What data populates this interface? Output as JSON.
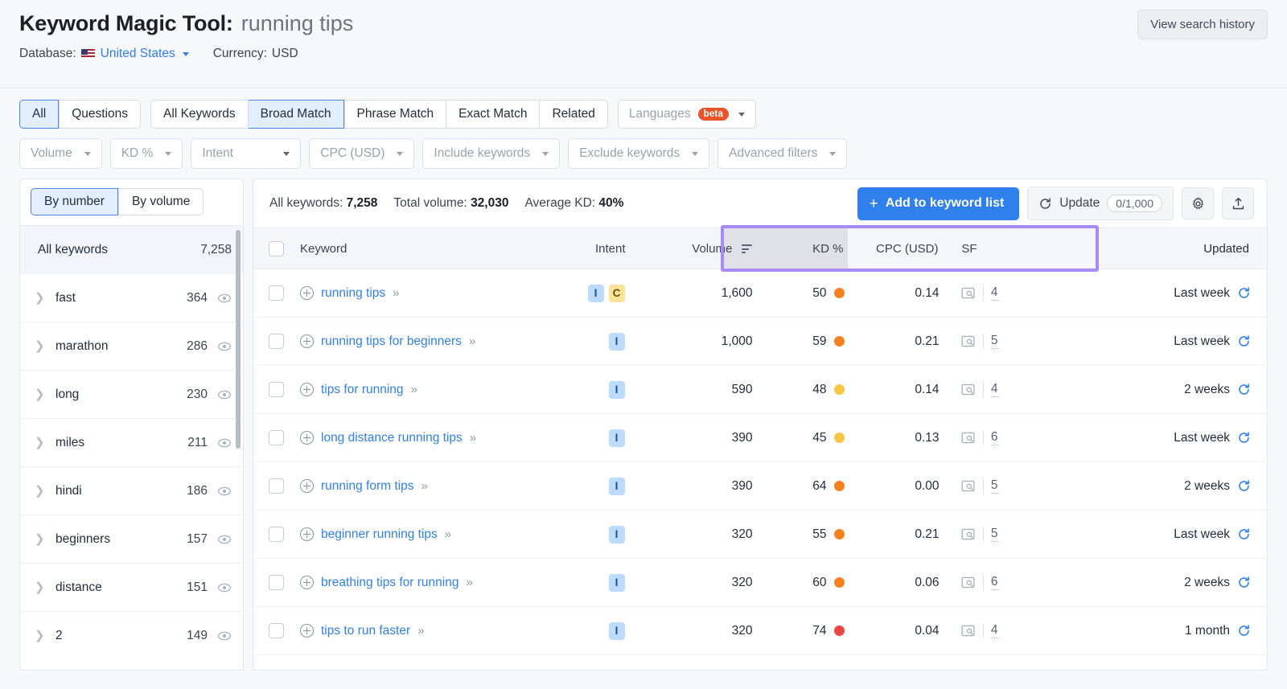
{
  "header": {
    "title_main": "Keyword Magic Tool:",
    "title_query": "running tips",
    "database_label": "Database:",
    "database_value": "United States",
    "currency_label": "Currency:",
    "currency_value": "USD",
    "search_history_button": "View search history"
  },
  "filters": {
    "match_tabs_group1": [
      {
        "label": "All",
        "active": true
      },
      {
        "label": "Questions",
        "active": false
      }
    ],
    "match_tabs_group2": [
      {
        "label": "All Keywords",
        "active": false
      },
      {
        "label": "Broad Match",
        "active": true
      },
      {
        "label": "Phrase Match",
        "active": false
      },
      {
        "label": "Exact Match",
        "active": false
      },
      {
        "label": "Related",
        "active": false
      }
    ],
    "languages_label": "Languages",
    "languages_beta": "beta",
    "dropdowns": [
      {
        "label": "Volume"
      },
      {
        "label": "KD %"
      },
      {
        "label": "Intent"
      },
      {
        "label": "CPC (USD)"
      },
      {
        "label": "Include keywords"
      },
      {
        "label": "Exclude keywords"
      },
      {
        "label": "Advanced filters"
      }
    ]
  },
  "sidebar": {
    "toggle": [
      {
        "label": "By number",
        "active": true
      },
      {
        "label": "By volume",
        "active": false
      }
    ],
    "all_keywords_label": "All keywords",
    "all_keywords_count": "7,258",
    "groups": [
      {
        "name": "fast",
        "count": "364"
      },
      {
        "name": "marathon",
        "count": "286"
      },
      {
        "name": "long",
        "count": "230"
      },
      {
        "name": "miles",
        "count": "211"
      },
      {
        "name": "hindi",
        "count": "186"
      },
      {
        "name": "beginners",
        "count": "157"
      },
      {
        "name": "distance",
        "count": "151"
      },
      {
        "name": "2",
        "count": "149"
      }
    ]
  },
  "toolbar": {
    "all_keywords_label": "All keywords:",
    "all_keywords_value": "7,258",
    "total_volume_label": "Total volume:",
    "total_volume_value": "32,030",
    "average_kd_label": "Average KD:",
    "average_kd_value": "40%",
    "add_button": "Add to keyword list",
    "add_button_plus": "+",
    "update_label": "Update",
    "update_count": "0/1,000",
    "settings_icon": "gear-icon",
    "export_icon": "upload-icon"
  },
  "table": {
    "columns": {
      "keyword": "Keyword",
      "intent": "Intent",
      "volume": "Volume",
      "kd": "KD %",
      "cpc": "CPC (USD)",
      "sf": "SF",
      "updated": "Updated"
    },
    "sorted_by": "Volume",
    "highlight_color": "#a78bfa",
    "rows": [
      {
        "keyword": "running tips",
        "intents": [
          "I",
          "C"
        ],
        "volume": "1,600",
        "kd": "50",
        "kd_color": "#f58220",
        "cpc": "0.14",
        "sf": "4",
        "updated": "Last week"
      },
      {
        "keyword": "running tips for beginners",
        "intents": [
          "I"
        ],
        "volume": "1,000",
        "kd": "59",
        "kd_color": "#f58220",
        "cpc": "0.21",
        "sf": "5",
        "updated": "Last week"
      },
      {
        "keyword": "tips for running",
        "intents": [
          "I"
        ],
        "volume": "590",
        "kd": "48",
        "kd_color": "#f7c645",
        "cpc": "0.14",
        "sf": "4",
        "updated": "2 weeks"
      },
      {
        "keyword": "long distance running tips",
        "intents": [
          "I"
        ],
        "volume": "390",
        "kd": "45",
        "kd_color": "#f7c645",
        "cpc": "0.13",
        "sf": "6",
        "updated": "Last week"
      },
      {
        "keyword": "running form tips",
        "intents": [
          "I"
        ],
        "volume": "390",
        "kd": "64",
        "kd_color": "#f58220",
        "cpc": "0.00",
        "sf": "5",
        "updated": "2 weeks"
      },
      {
        "keyword": "beginner running tips",
        "intents": [
          "I"
        ],
        "volume": "320",
        "kd": "55",
        "kd_color": "#f58220",
        "cpc": "0.21",
        "sf": "5",
        "updated": "Last week"
      },
      {
        "keyword": "breathing tips for running",
        "intents": [
          "I"
        ],
        "volume": "320",
        "kd": "60",
        "kd_color": "#f58220",
        "cpc": "0.06",
        "sf": "6",
        "updated": "2 weeks"
      },
      {
        "keyword": "tips to run faster",
        "intents": [
          "I"
        ],
        "volume": "320",
        "kd": "74",
        "kd_color": "#ef4444",
        "cpc": "0.04",
        "sf": "4",
        "updated": "1 month"
      }
    ]
  },
  "colors": {
    "accent_blue": "#2f80ed",
    "highlight_purple": "#a78bfa",
    "beta_orange": "#e8552a"
  }
}
